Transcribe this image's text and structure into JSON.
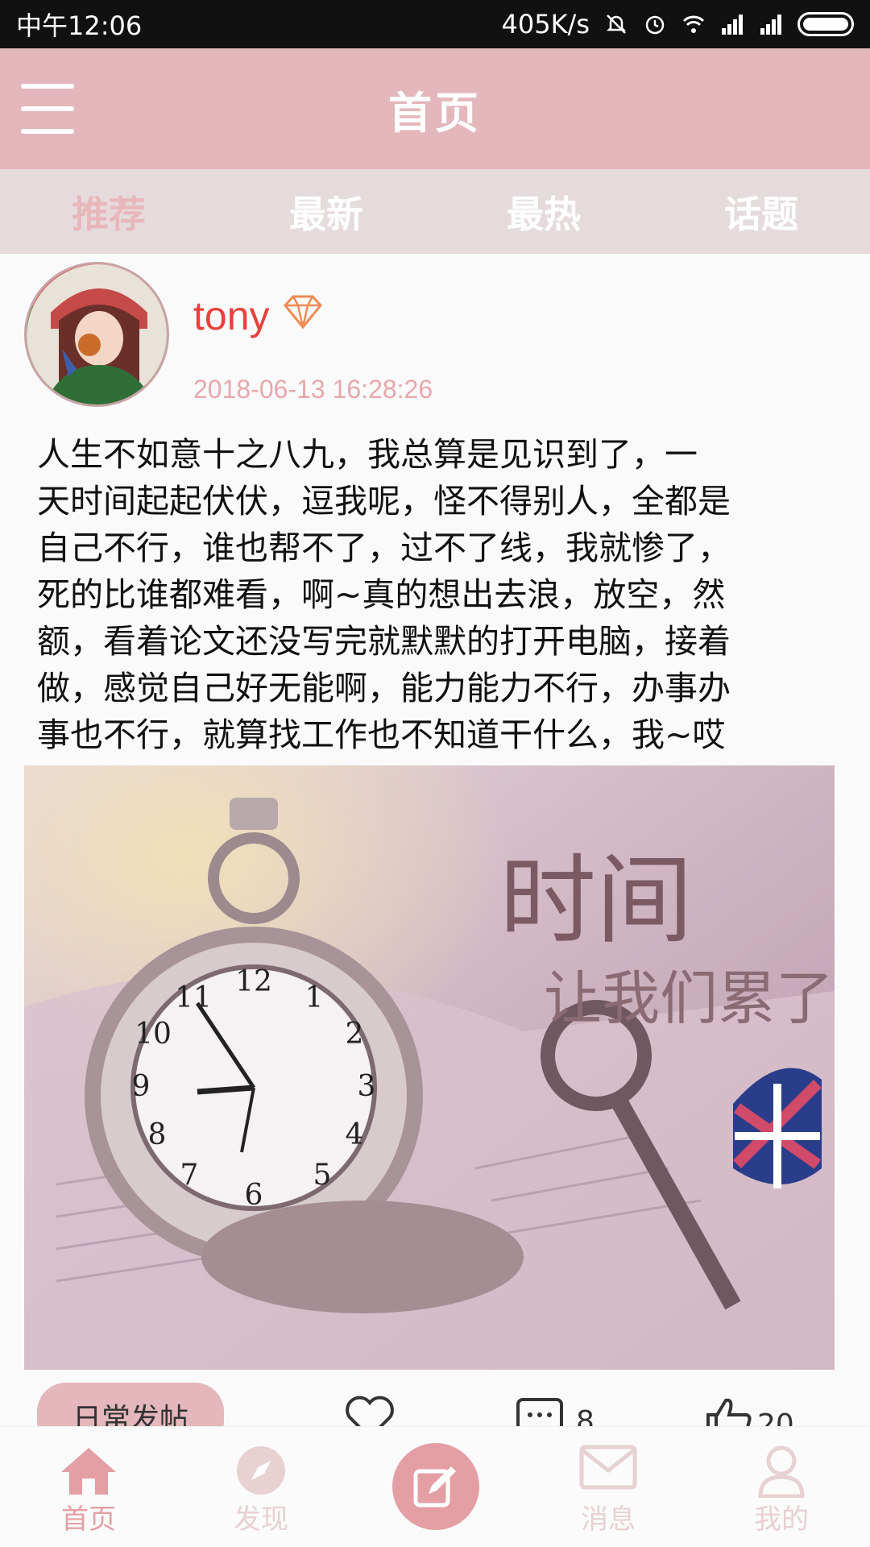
{
  "status_bar": {
    "time": "中午12:06",
    "network_speed": "405K/s"
  },
  "header": {
    "title": "首页"
  },
  "tabs": [
    {
      "label": "推荐",
      "active": true
    },
    {
      "label": "最新",
      "active": false
    },
    {
      "label": "最热",
      "active": false
    },
    {
      "label": "话题",
      "active": false
    }
  ],
  "post": {
    "username": "tony",
    "timestamp": "2018-06-13 16:28:26",
    "lines": [
      "人生不如意十之八九，我总算是见识到了，一",
      "天时间起起伏伏，逗我呢，怪不得别人，全都是",
      "自己不行，谁也帮不了，过不了线，我就惨了，",
      "死的比谁都难看，啊~真的想出去浪，放空，然",
      "额，看着论文还没写完就默默的打开电脑，接着",
      "做，感觉自己好无能啊，能力能力不行，办事办",
      "事也不行，就算找工作也不知道干什么，我~哎"
    ],
    "image_text": {
      "line1": "时间",
      "line2": "让我们累了"
    },
    "category": "日常发帖",
    "comment_count": "8",
    "like_count": "20"
  },
  "bottom_nav": {
    "home": "首页",
    "discover": "发现",
    "message": "消息",
    "mine": "我的"
  },
  "colors": {
    "header_bg": "#e3b7bb",
    "tab_bar_bg": "#e6dbdc",
    "accent": "#e39fa4",
    "username": "#e6433f"
  }
}
